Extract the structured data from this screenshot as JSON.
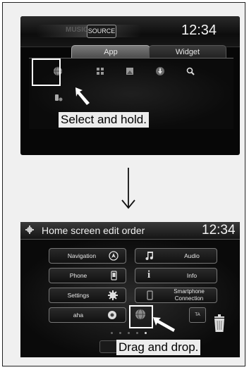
{
  "screen1": {
    "faded_label": "MUSIC",
    "source_button": "SOURCE",
    "clock": "12:34",
    "tabs": [
      {
        "label": "App",
        "selected": true
      },
      {
        "label": "Widget",
        "selected": false
      }
    ],
    "app_icons": [
      "globe-icon",
      "grid-icon",
      "gallery-icon",
      "download-icon",
      "search-icon",
      "phone-settings-icon"
    ],
    "caption": "Select and hold."
  },
  "screen2": {
    "title": "Home screen edit order",
    "clock": "12:34",
    "tiles": [
      {
        "label": "Navigation",
        "icon": "navigation-icon"
      },
      {
        "label": "Phone",
        "icon": "phone-icon"
      },
      {
        "label": "Settings",
        "icon": "gear-icon"
      },
      {
        "label": "aha",
        "icon": "aha-icon"
      },
      {
        "label": "Audio",
        "icon": "music-note-icon"
      },
      {
        "label": "Info",
        "icon": "info-icon"
      },
      {
        "label": "Smartphone Connection",
        "icon": "smartphone-icon"
      },
      {
        "label": "TA",
        "icon": "ta-icon"
      }
    ],
    "trash_icon": "trash-icon",
    "caption": "Drag and drop."
  }
}
